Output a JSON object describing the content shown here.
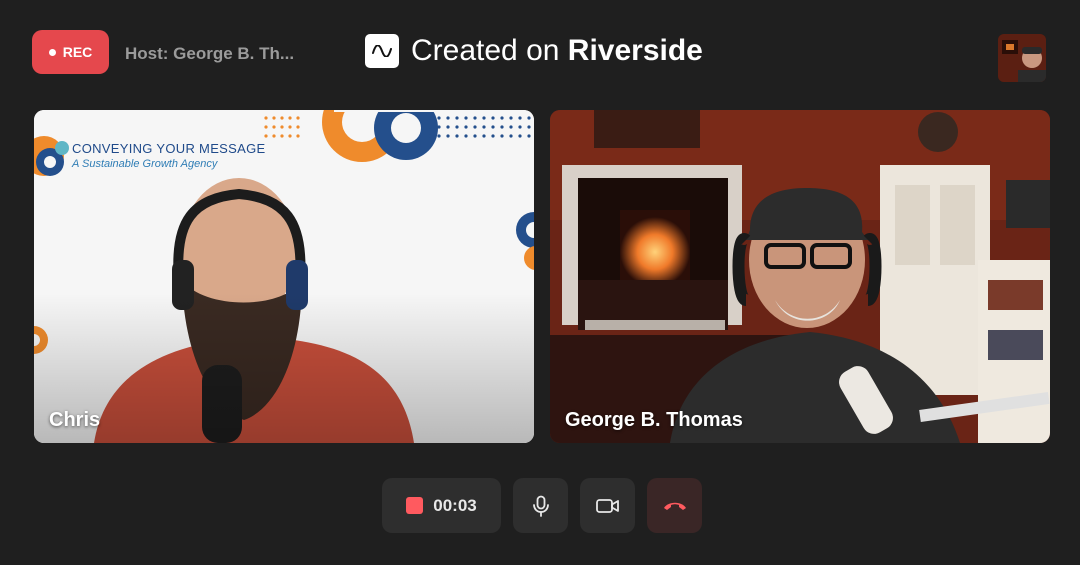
{
  "header": {
    "rec_label": "REC",
    "host_label": "Host: George B. Th...",
    "brand_prefix": "Created on",
    "brand_name": "Riverside"
  },
  "participants": [
    {
      "name": "Chris",
      "background_line1": "CONVEYING YOUR MESSAGE",
      "background_line2": "A Sustainable Growth Agency"
    },
    {
      "name": "George B. Thomas"
    }
  ],
  "controls": {
    "timer": "00:03",
    "icons": [
      "stop-record-icon",
      "microphone-icon",
      "camera-icon",
      "hang-up-icon"
    ]
  },
  "colors": {
    "accent_red": "#e5484d",
    "stop_red": "#ff5a5f",
    "background": "#1f1f1f",
    "control_bg": "#2e2e2e"
  }
}
